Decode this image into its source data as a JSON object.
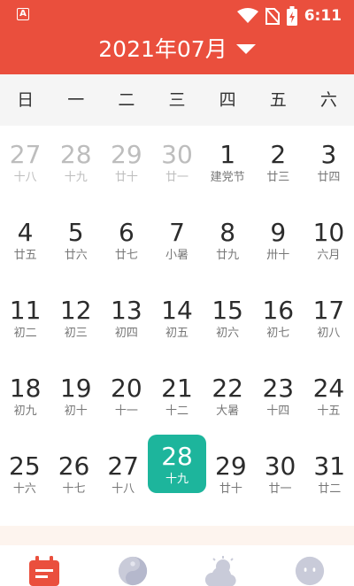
{
  "status_bar": {
    "app_icon_letter": "A",
    "time": "6:11"
  },
  "header": {
    "month_title": "2021年07月"
  },
  "weekdays": [
    "日",
    "一",
    "二",
    "三",
    "四",
    "五",
    "六"
  ],
  "calendar": {
    "weeks": [
      [
        {
          "num": "27",
          "sub": "十八",
          "faded": true
        },
        {
          "num": "28",
          "sub": "十九",
          "faded": true
        },
        {
          "num": "29",
          "sub": "廿十",
          "faded": true
        },
        {
          "num": "30",
          "sub": "廿一",
          "faded": true
        },
        {
          "num": "1",
          "sub": "建党节"
        },
        {
          "num": "2",
          "sub": "廿三"
        },
        {
          "num": "3",
          "sub": "廿四"
        }
      ],
      [
        {
          "num": "4",
          "sub": "廿五"
        },
        {
          "num": "5",
          "sub": "廿六"
        },
        {
          "num": "6",
          "sub": "廿七"
        },
        {
          "num": "7",
          "sub": "小暑"
        },
        {
          "num": "8",
          "sub": "廿九"
        },
        {
          "num": "9",
          "sub": "卅十"
        },
        {
          "num": "10",
          "sub": "六月"
        }
      ],
      [
        {
          "num": "11",
          "sub": "初二"
        },
        {
          "num": "12",
          "sub": "初三"
        },
        {
          "num": "13",
          "sub": "初四"
        },
        {
          "num": "14",
          "sub": "初五"
        },
        {
          "num": "15",
          "sub": "初六"
        },
        {
          "num": "16",
          "sub": "初七"
        },
        {
          "num": "17",
          "sub": "初八"
        }
      ],
      [
        {
          "num": "18",
          "sub": "初九"
        },
        {
          "num": "19",
          "sub": "初十"
        },
        {
          "num": "20",
          "sub": "十一"
        },
        {
          "num": "21",
          "sub": "十二"
        },
        {
          "num": "22",
          "sub": "大暑"
        },
        {
          "num": "23",
          "sub": "十四"
        },
        {
          "num": "24",
          "sub": "十五"
        }
      ],
      [
        {
          "num": "25",
          "sub": "十六"
        },
        {
          "num": "26",
          "sub": "十七"
        },
        {
          "num": "27",
          "sub": "十八"
        },
        {
          "num": "28",
          "sub": "十九",
          "today": true
        },
        {
          "num": "29",
          "sub": "廿十"
        },
        {
          "num": "30",
          "sub": "廿一"
        },
        {
          "num": "31",
          "sub": "廿二"
        }
      ]
    ]
  },
  "tabs": [
    {
      "icon": "calendar-icon",
      "active": true
    },
    {
      "icon": "yin-yang-icon"
    },
    {
      "icon": "weather-icon"
    },
    {
      "icon": "face-icon"
    }
  ],
  "colors": {
    "brand_red": "#ea4f3d",
    "today_green": "#1db59c"
  }
}
